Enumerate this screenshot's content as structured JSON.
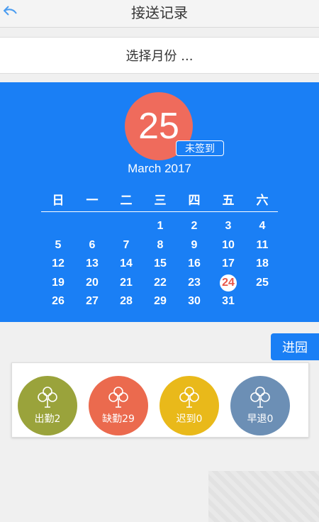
{
  "header": {
    "title": "接送记录"
  },
  "month_picker": {
    "label": "选择月份 ..."
  },
  "calendar": {
    "selected_day": "25",
    "signin_status": "未签到",
    "month_year": "March 2017",
    "weekdays": [
      "日",
      "一",
      "二",
      "三",
      "四",
      "五",
      "六"
    ],
    "first_weekday_index": 3,
    "days_in_month": 31,
    "today": 24
  },
  "enter_button": {
    "label": "进园"
  },
  "stats": [
    {
      "label": "出勤2",
      "color": "#9aa33b"
    },
    {
      "label": "缺勤29",
      "color": "#eb6a4e"
    },
    {
      "label": "迟到0",
      "color": "#e9b91a"
    },
    {
      "label": "早退0",
      "color": "#6c8fb5"
    }
  ],
  "colors": {
    "calendar_bg": "#1a7ff5",
    "day_circle": "#ef6b5c"
  }
}
